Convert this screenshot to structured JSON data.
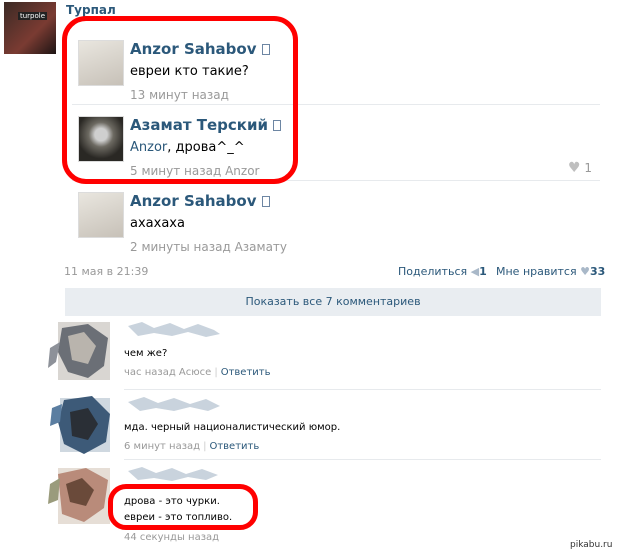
{
  "post": {
    "author": "Турпал",
    "avatar_badge": "turpole",
    "date": "11 мая в 21:39",
    "share_label": "Поделиться",
    "share_count": "1",
    "like_label": "Мне нравится",
    "like_count": "33"
  },
  "replies": [
    {
      "name": "Anzor Sahabov",
      "text": "евреи кто такие?",
      "link": "",
      "meta": "13 минут назад",
      "likes": ""
    },
    {
      "name": "Азамат Терский",
      "link": "Anzor",
      "text": ", дрова^_^",
      "meta": "5 минут назад Anzor",
      "likes": "1"
    },
    {
      "name": "Anzor Sahabov",
      "text": "ахахаха",
      "link": "",
      "meta": "2 минуты назад Азамату",
      "likes": ""
    }
  ],
  "show_all": "Показать все 7 комментариев",
  "comments": [
    {
      "lines": [
        "чем же?"
      ],
      "time": "час назад Асюсе",
      "reply": "Ответить"
    },
    {
      "lines": [
        "мда. черный националистический юмор."
      ],
      "time": "6 минут назад",
      "reply": "Ответить"
    },
    {
      "lines": [
        "дрова - это чурки.",
        "евреи - это топливо."
      ],
      "time": "44 секунды назад",
      "reply": ""
    }
  ],
  "watermark": "pikabu.ru",
  "colors": {
    "link": "#2b587a",
    "highlight": "#ff0000",
    "muted": "#999999"
  }
}
